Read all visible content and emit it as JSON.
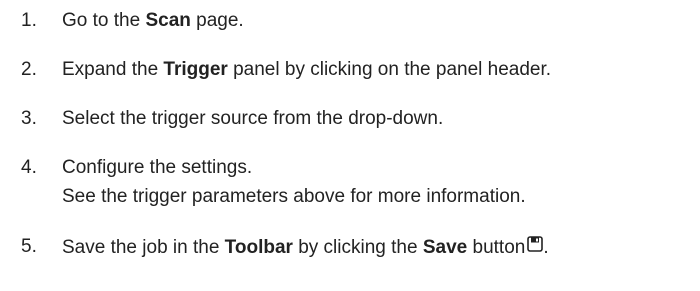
{
  "steps": [
    {
      "number": "1.",
      "pre": "Go to the ",
      "bold": "Scan",
      "post": " page."
    },
    {
      "number": "2.",
      "pre": "Expand the ",
      "bold": "Trigger",
      "post": " panel by clicking on the panel header."
    },
    {
      "number": "3.",
      "text": "Select the trigger source from the drop-down."
    },
    {
      "number": "4.",
      "text": "Configure the settings.",
      "note": "See the trigger parameters above for more information."
    },
    {
      "number": "5.",
      "pre": "Save the job in the ",
      "bold": "Toolbar",
      "mid": " by clicking the ",
      "bold2": "Save",
      "post": " button",
      "icon": "save-icon",
      "end": "."
    }
  ]
}
